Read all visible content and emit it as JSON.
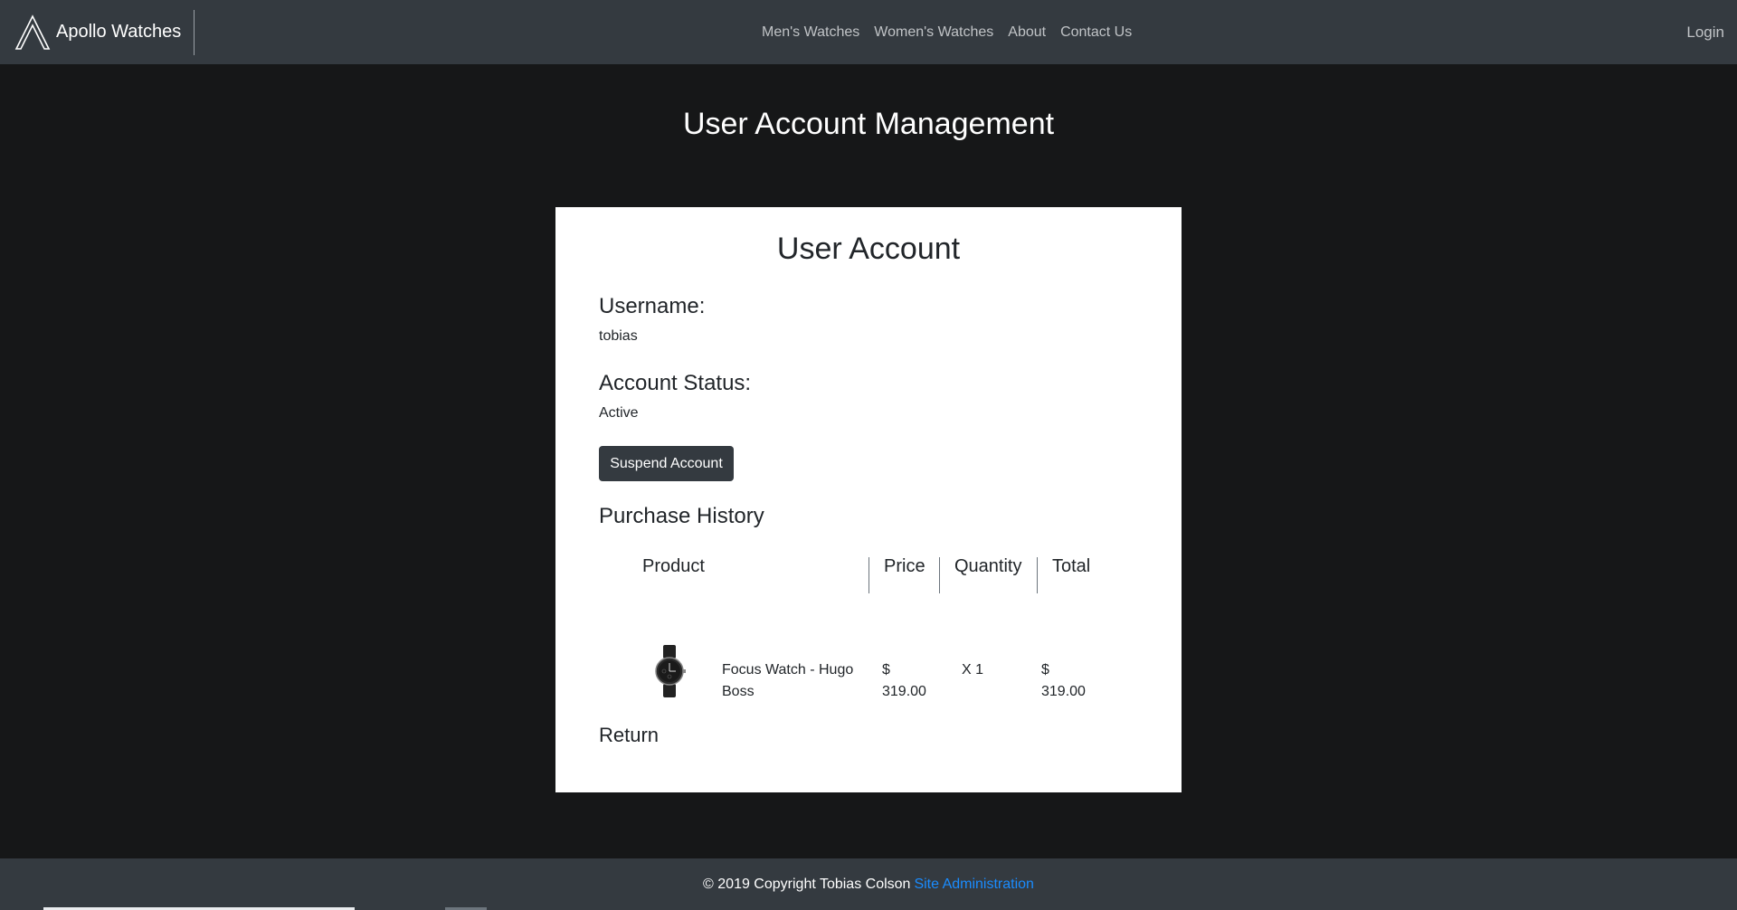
{
  "navbar": {
    "brand_name": "Apollo Watches",
    "links": [
      "Men's Watches",
      "Women's Watches",
      "About",
      "Contact Us"
    ],
    "login_label": "Login"
  },
  "page_title": "User Account Management",
  "account": {
    "card_title": "User Account",
    "username_label": "Username:",
    "username_value": "tobias",
    "status_label": "Account Status:",
    "status_value": "Active",
    "suspend_label": "Suspend Account"
  },
  "purchase_history": {
    "title": "Purchase History",
    "headers": {
      "product": "Product",
      "price": "Price",
      "quantity": "Quantity",
      "total": "Total"
    },
    "rows": [
      {
        "product_name_line1": "Focus Watch - Hugo",
        "product_name_line2": "Boss",
        "price_symbol": "$",
        "price_value": "319.00",
        "quantity": "X 1",
        "total_symbol": "$",
        "total_value": "319.00"
      }
    ]
  },
  "return_label": "Return",
  "footer": {
    "copyright": "© 2019 Copyright Tobias Colson",
    "admin_link": "Site Administration"
  },
  "colors": {
    "navbar_bg": "#343a40",
    "page_bg": "#161718",
    "card_bg": "#ffffff",
    "link_blue": "#1a8cff"
  },
  "icons": [
    "apollo-logo-icon",
    "watch-thumbnail"
  ]
}
